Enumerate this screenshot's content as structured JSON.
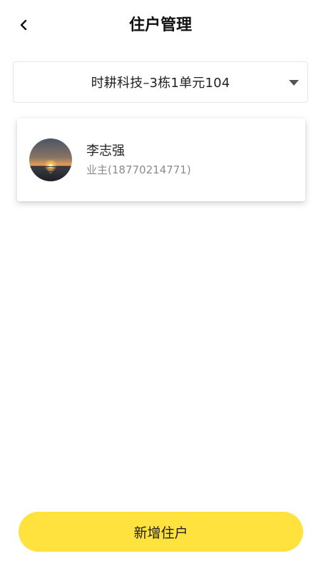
{
  "header": {
    "title": "住户管理",
    "back_icon": "chevron-left-icon"
  },
  "selector": {
    "value": "时耕科技–3栋1单元104",
    "arrow_icon": "caret-down-icon"
  },
  "residents": [
    {
      "name": "李志强",
      "role": "业主(18770214771)",
      "avatar": "sunset-avatar"
    }
  ],
  "add_button": {
    "label": "新增住户",
    "color": "#ffe23d"
  }
}
